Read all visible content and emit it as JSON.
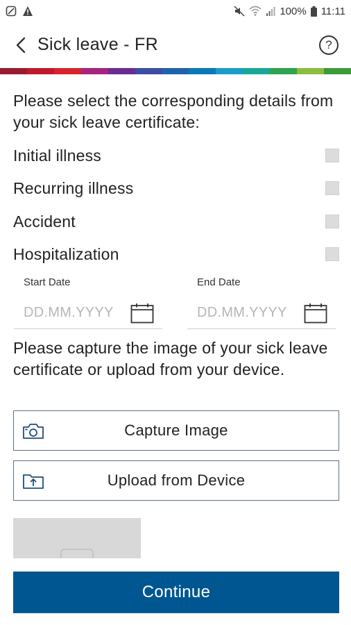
{
  "status_bar": {
    "battery": "100%",
    "time": "11:11"
  },
  "header": {
    "title": "Sick leave - FR",
    "help_glyph": "?"
  },
  "brand_stripe": [
    "#9a1b2f",
    "#c0182f",
    "#d8232a",
    "#a6247e",
    "#6a2c91",
    "#3b4ea1",
    "#1f63ae",
    "#0c79b8",
    "#1a9cc9",
    "#18a898",
    "#2fa34d",
    "#8bbd3f",
    "#3f9a3a"
  ],
  "form": {
    "intro": "Please select the corresponding details from your sick leave certificate:",
    "options": [
      {
        "label": "Initial illness"
      },
      {
        "label": "Recurring illness"
      },
      {
        "label": "Accident"
      },
      {
        "label": "Hospitalization"
      }
    ],
    "start_date": {
      "label": "Start Date",
      "placeholder": "DD.MM.YYYY"
    },
    "end_date": {
      "label": "End Date",
      "placeholder": "DD.MM.YYYY"
    },
    "capture_text": "Please capture the image of your sick leave certificate or upload from your device.",
    "capture_button": "Capture Image",
    "upload_button": "Upload from Device",
    "continue_button": "Continue"
  },
  "colors": {
    "primary": "#005691",
    "button_border": "#5b6f86",
    "checkbox": "#dcdcdc"
  }
}
